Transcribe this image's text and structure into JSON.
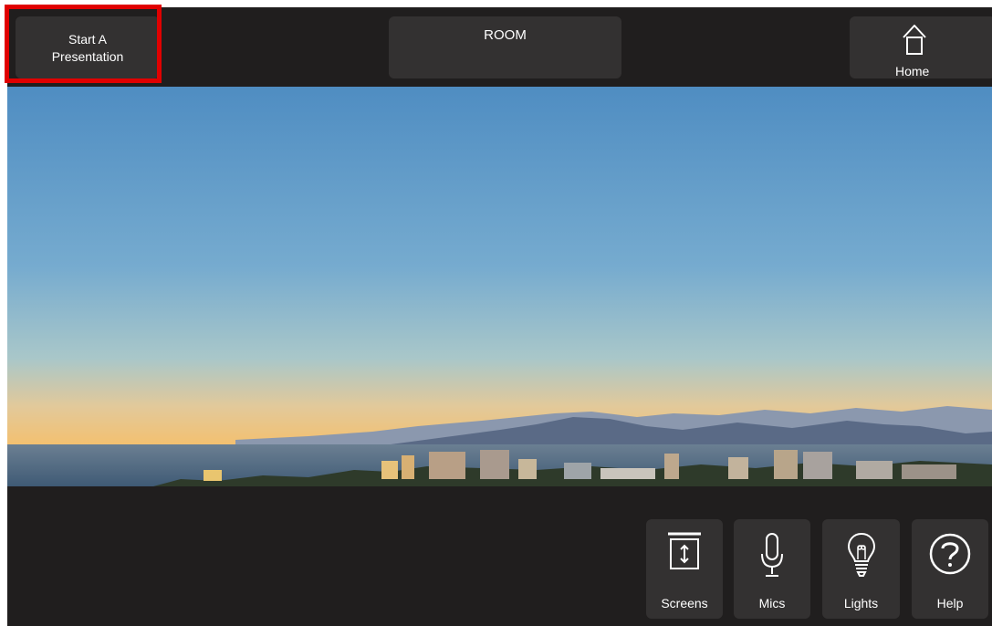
{
  "topbar": {
    "start_presentation_line1": "Start A",
    "start_presentation_line2": "Presentation",
    "room_label": "ROOM",
    "home_label": "Home"
  },
  "bottombar": {
    "screens_label": "Screens",
    "mics_label": "Mics",
    "lights_label": "Lights",
    "help_label": "Help"
  },
  "icons": {
    "home": "home-icon",
    "screens": "screen-icon",
    "mics": "microphone-icon",
    "lights": "lightbulb-icon",
    "help": "help-icon"
  },
  "colors": {
    "panel_background": "#201e1e",
    "button_background": "#333131",
    "highlight": "#e00000",
    "text": "#ffffff"
  }
}
